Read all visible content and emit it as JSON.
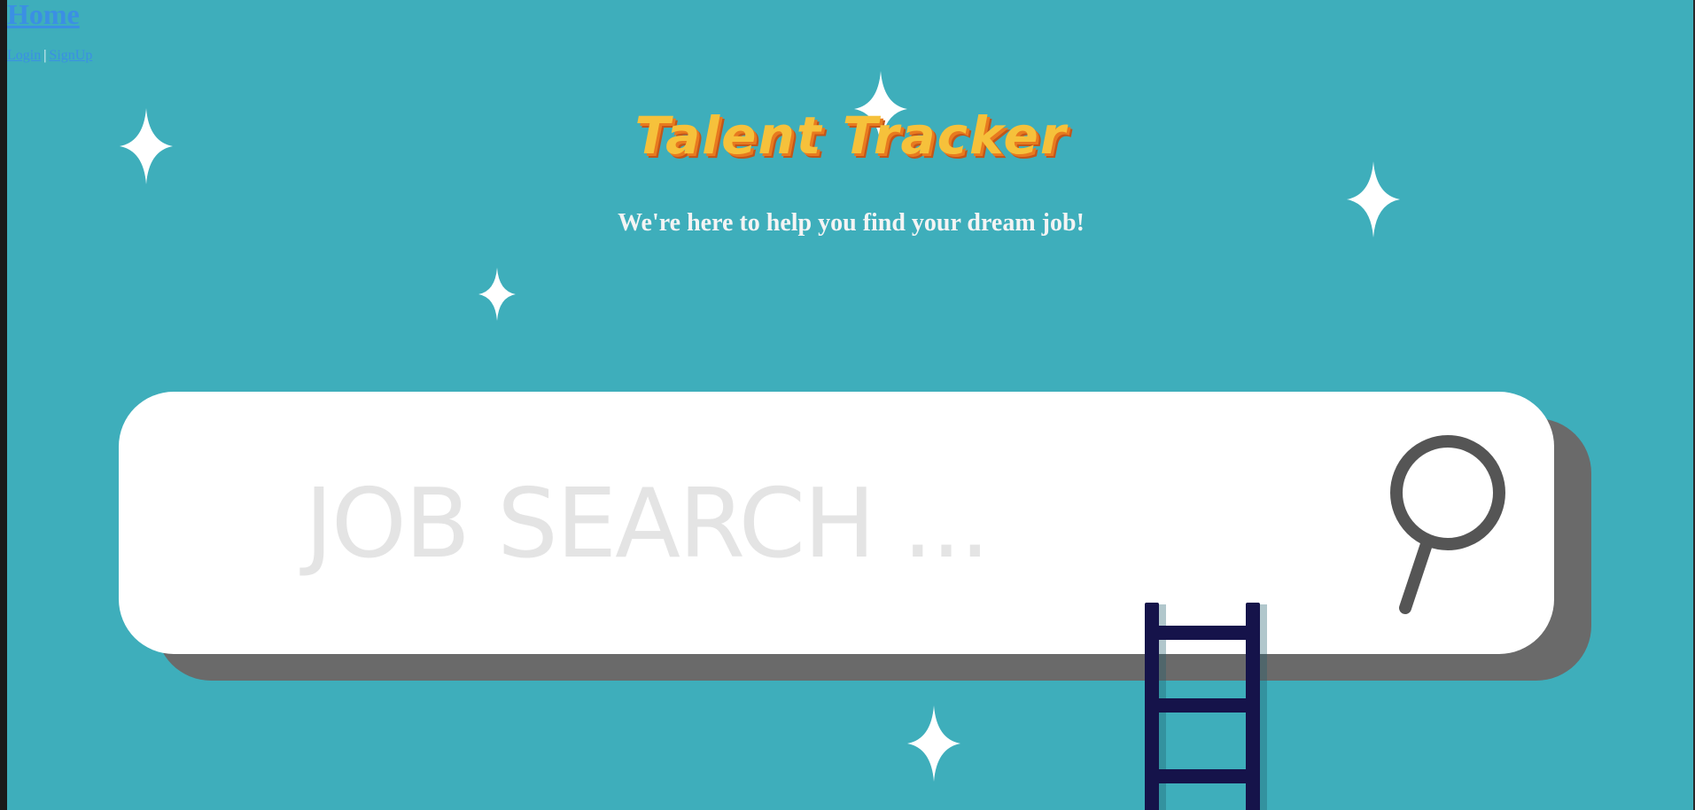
{
  "nav": {
    "home_label": "Home",
    "login_label": "Login",
    "separator": "|",
    "signup_label": "SignUp"
  },
  "hero": {
    "brand_title": "Talent Tracker",
    "tagline": "We're here to help you find your dream job!",
    "search_placeholder": "JOB SEARCH ..."
  },
  "colors": {
    "background": "#3eaebb",
    "brand_yellow": "#f6c13b",
    "brand_orange": "#e87a1f",
    "link_blue": "#3b8fe4",
    "search_box": "#ffffff",
    "search_shadow": "#6a6a6a",
    "ladder_navy": "#15134a"
  },
  "icons": {
    "search": "magnifier-icon",
    "ladder": "ladder-illustration",
    "sparkle": "sparkle-icon"
  }
}
